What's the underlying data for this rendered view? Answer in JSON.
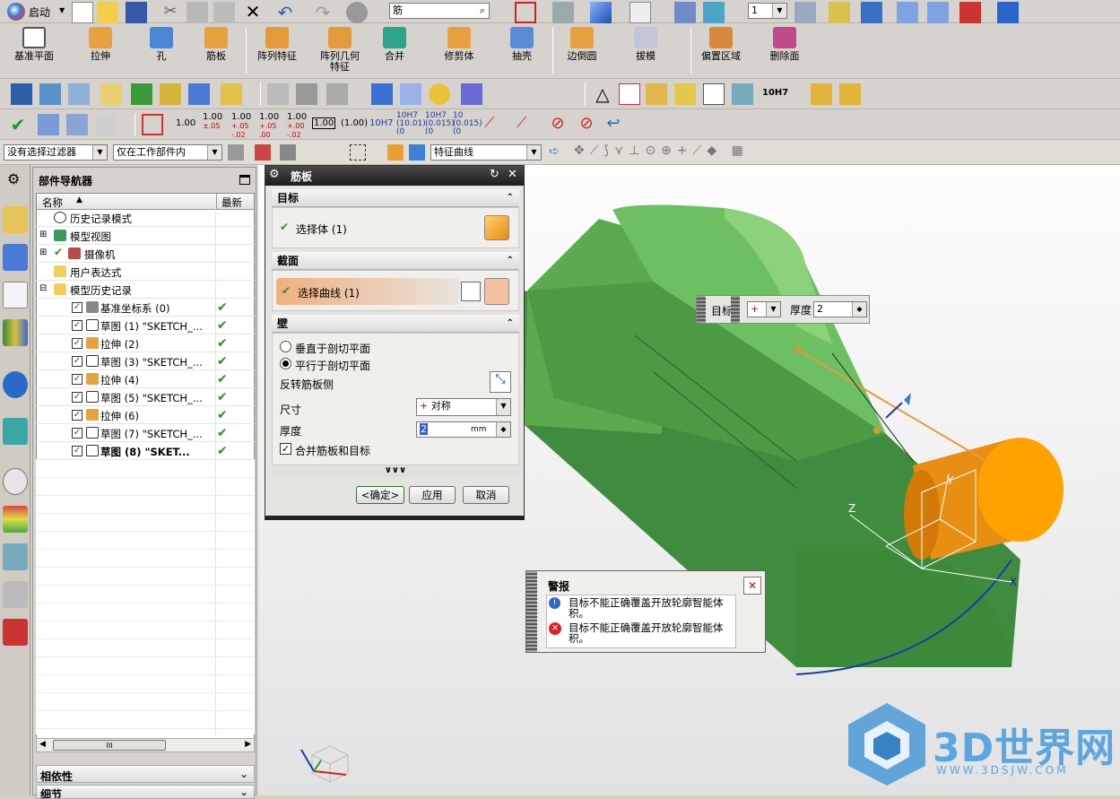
{
  "app": {
    "start_label": "启动"
  },
  "toolbar1": {
    "search_value": "筋",
    "layer_value": "1"
  },
  "toolbar2": {
    "buttons": [
      {
        "label": "基准平面"
      },
      {
        "label": "拉伸"
      },
      {
        "label": "孔"
      },
      {
        "label": "筋板"
      },
      {
        "label": "阵列特征"
      },
      {
        "label": "阵列几何",
        "label2": "特征"
      },
      {
        "label": "合并"
      },
      {
        "label": "修剪体"
      },
      {
        "label": "抽壳"
      },
      {
        "label": "边倒圆"
      },
      {
        "label": "拔模"
      },
      {
        "label": "偏置区域"
      },
      {
        "label": "删除面"
      }
    ]
  },
  "toolbar4": {
    "tolerances": [
      "1.00",
      "1.00\n±.05",
      "1.00\n+.05\n-.02",
      "1.00\n+.05\n.00",
      "1.00\n+.00\n-.02"
    ],
    "boxed1": "1.00",
    "paren": "(1.00)",
    "fits": [
      "10H7",
      "10H7\n(10.01)\n(0)",
      "10H7\n(0.015)\n(0)",
      "10\n(0.015)\n(0)"
    ],
    "snap_label": "10H7"
  },
  "filterbar": {
    "filter": "没有选择过滤器",
    "scope": "仅在工作部件内",
    "curve_rule": "特征曲线"
  },
  "navigator": {
    "title": "部件导航器",
    "col_name": "名称",
    "col_latest": "最新",
    "rows": [
      {
        "label": "历史记录模式",
        "indent": 0
      },
      {
        "label": "模型视图",
        "indent": 0
      },
      {
        "label": "摄像机",
        "indent": 0
      },
      {
        "label": "用户表达式",
        "indent": 0
      },
      {
        "label": "模型历史记录",
        "indent": 0
      },
      {
        "label": "基准坐标系 (0)",
        "indent": 1
      },
      {
        "label": "草图 (1) \"SKETCH_...",
        "indent": 1
      },
      {
        "label": "拉伸 (2)",
        "indent": 1
      },
      {
        "label": "草图 (3) \"SKETCH_...",
        "indent": 1
      },
      {
        "label": "拉伸 (4)",
        "indent": 1
      },
      {
        "label": "草图 (5) \"SKETCH_...",
        "indent": 1
      },
      {
        "label": "拉伸 (6)",
        "indent": 1
      },
      {
        "label": "草图 (7) \"SKETCH_...",
        "indent": 1
      },
      {
        "label": "草图 (8) \"SKET...",
        "indent": 1
      }
    ],
    "scroll_grip": "III",
    "dependency_label": "相依性",
    "details_label": "细节"
  },
  "dialog": {
    "title": "筋板",
    "target_section": "目标",
    "select_body": "选择体 (1)",
    "section_section": "截面",
    "select_curve": "选择曲线 (1)",
    "wall_section": "壁",
    "radio_perp": "垂直于剖切平面",
    "radio_parallel": "平行于剖切平面",
    "reverse_label": "反转筋板侧",
    "dim_label": "尺寸",
    "dim_value": "对称",
    "thickness_label": "厚度",
    "thickness_value": "2",
    "thickness_unit": "mm",
    "merge_label": "合并筋板和目标",
    "more": "∨∨∨",
    "ok": "<确定>",
    "apply": "应用",
    "cancel": "取消"
  },
  "viewport": {
    "floating_target": "目标",
    "floating_thickness_label": "厚度",
    "floating_thickness_value": "2",
    "axis_x": "X",
    "axis_y": "Y",
    "axis_z": "Z",
    "watermark_main": "3D世界网",
    "watermark_sub": "WWW.3DSJW.COM"
  },
  "alert": {
    "title": "警报",
    "info_msg": "目标不能正确覆盖开放轮廓智能体积。",
    "error_msg": "目标不能正确覆盖开放轮廓智能体积。"
  }
}
